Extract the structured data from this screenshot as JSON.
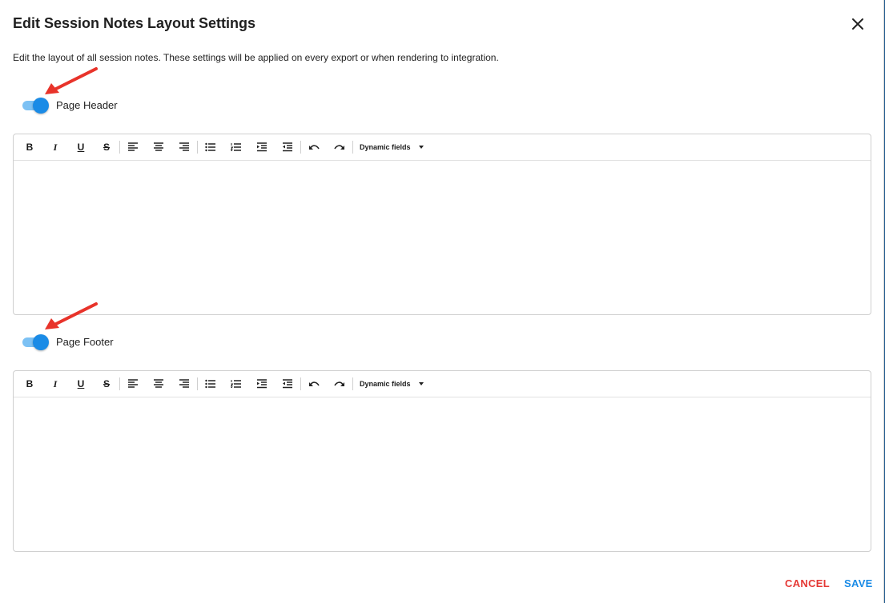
{
  "dialog": {
    "title": "Edit Session Notes Layout Settings",
    "description": "Edit the layout of all session notes. These settings will be applied on every export or when rendering to integration."
  },
  "header_section": {
    "toggle_label": "Page Header",
    "enabled": true
  },
  "footer_section": {
    "toggle_label": "Page Footer",
    "enabled": true
  },
  "toolbar": {
    "bold": "B",
    "italic": "I",
    "underline": "U",
    "strike": "S",
    "dynamic_fields": "Dynamic fields"
  },
  "actions": {
    "cancel": "CANCEL",
    "save": "SAVE"
  },
  "colors": {
    "accent": "#1a8be6",
    "cancel": "#e53935",
    "annotation_arrow": "#e8332a"
  },
  "icons": [
    "close-icon",
    "align-left-icon",
    "align-center-icon",
    "align-right-icon",
    "bullet-list-icon",
    "numbered-list-icon",
    "indent-icon",
    "outdent-icon",
    "undo-icon",
    "redo-icon",
    "caret-down-icon",
    "annotation-arrow-icon"
  ]
}
